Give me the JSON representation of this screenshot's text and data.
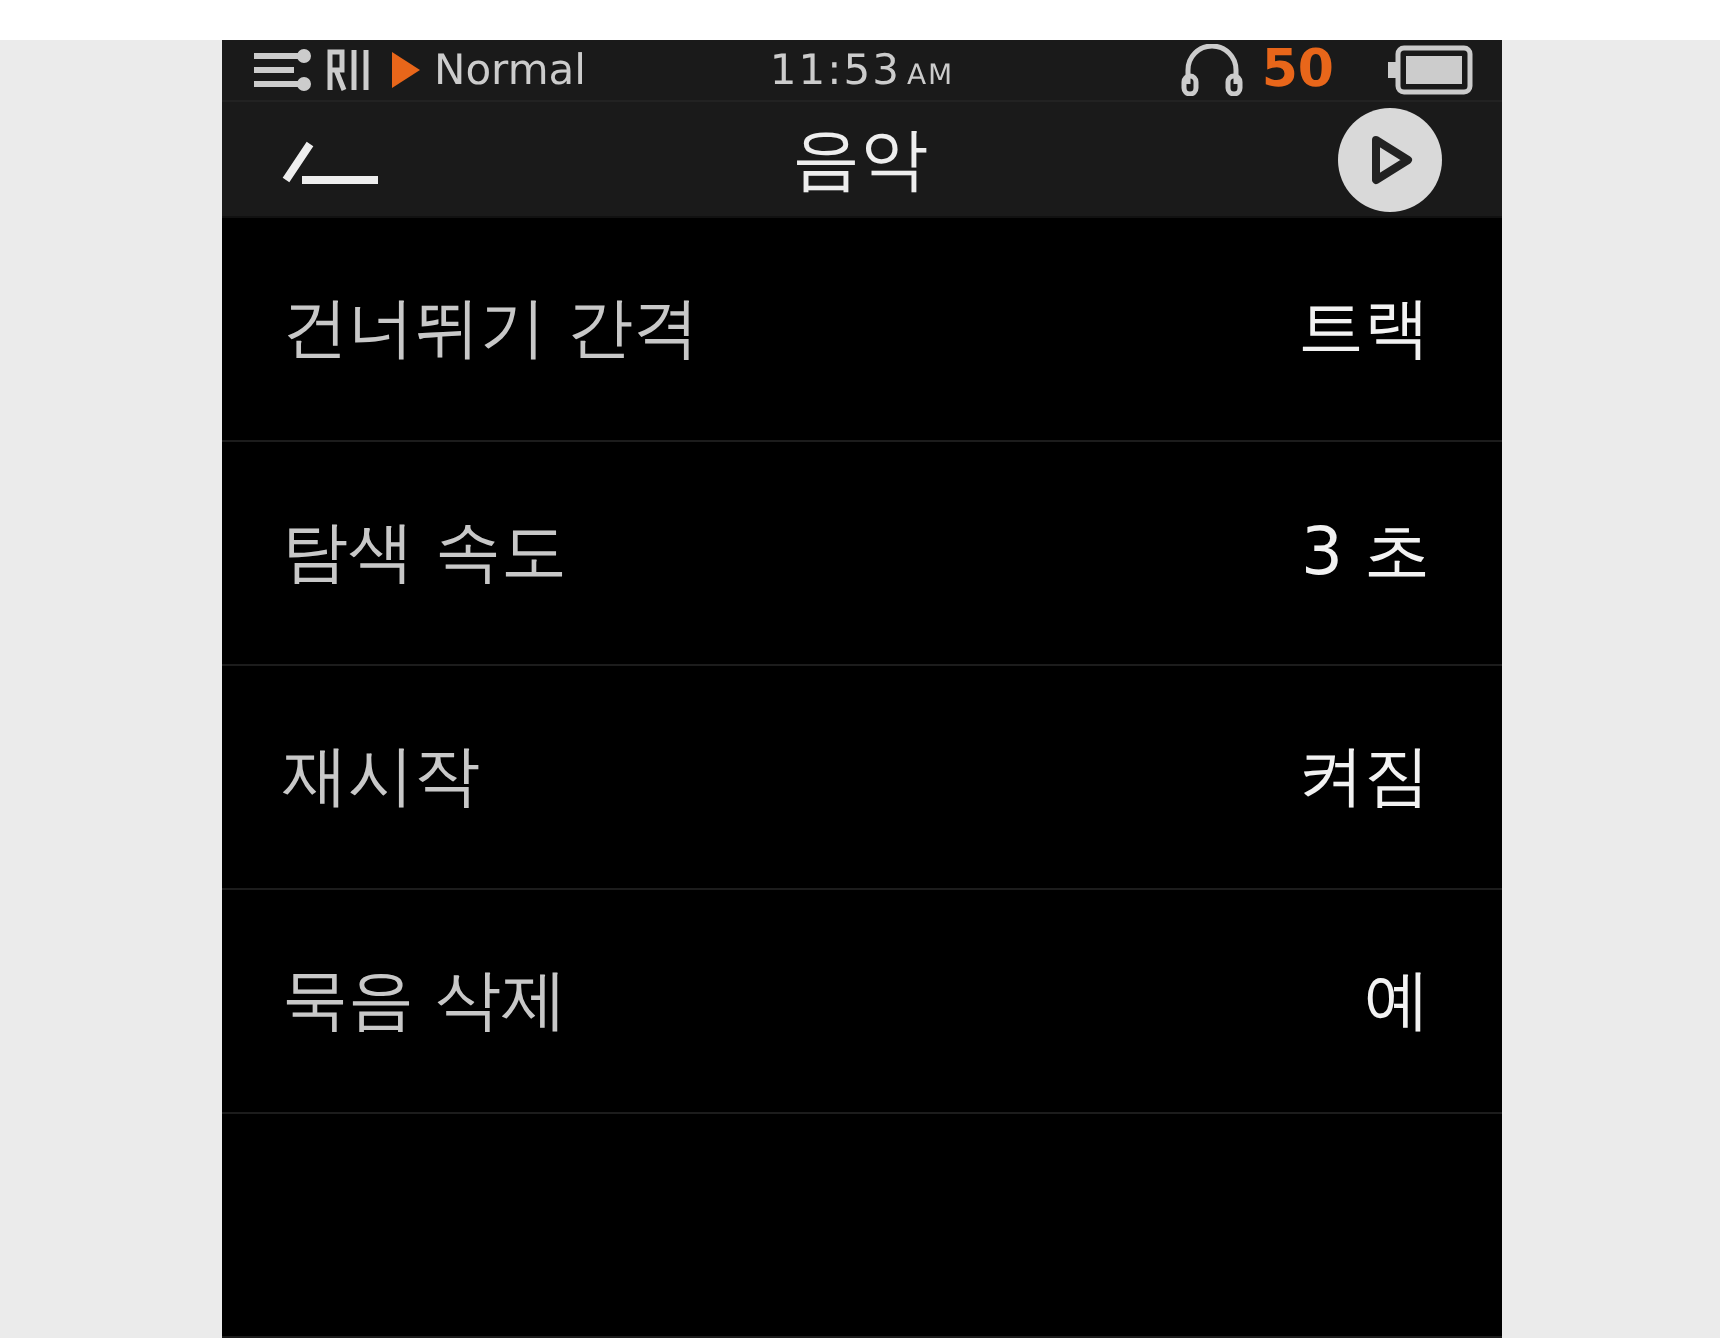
{
  "status_bar": {
    "eq_mode": "Normal",
    "time": "11:53",
    "meridiem": "AM",
    "volume": "50"
  },
  "header": {
    "title": "음악"
  },
  "settings": [
    {
      "label": "건너뛰기 간격",
      "value": "트랙"
    },
    {
      "label": "탐색 속도",
      "value": "3 초"
    },
    {
      "label": "재시작",
      "value": "켜짐"
    },
    {
      "label": "묵음 삭제",
      "value": "예"
    }
  ]
}
